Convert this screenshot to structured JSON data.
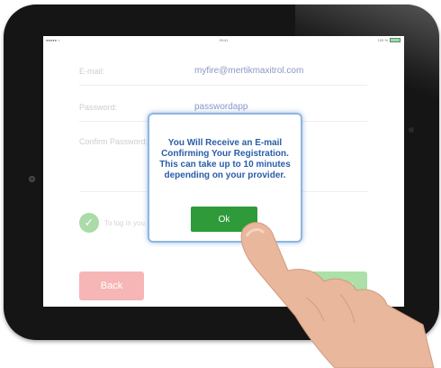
{
  "status_bar": {
    "signal": "●●●●● ≈",
    "time": "09:41",
    "battery": "100 %"
  },
  "form": {
    "email_label": "E-mail:",
    "email_value": "myfire@mertikmaxitrol.com",
    "password_label": "Password:",
    "password_value": "passwordapp",
    "confirm_label": "Confirm Password:",
    "terms_text": "To log in you",
    "back_button": "Back",
    "register_button": "Register"
  },
  "dialog": {
    "message": "You Will Receive an E-mail Confirming Your Registration. This can take up to 10 minutes depending on your provider.",
    "ok_button": "Ok"
  },
  "colors": {
    "back": "#f28f8f",
    "register": "#7fd07a",
    "ok": "#2e9a3a",
    "dialog_text": "#2a5da8",
    "dialog_border": "#8fb6e0"
  },
  "icons": [
    "checkmark-icon",
    "battery-icon",
    "signal-icon"
  ]
}
